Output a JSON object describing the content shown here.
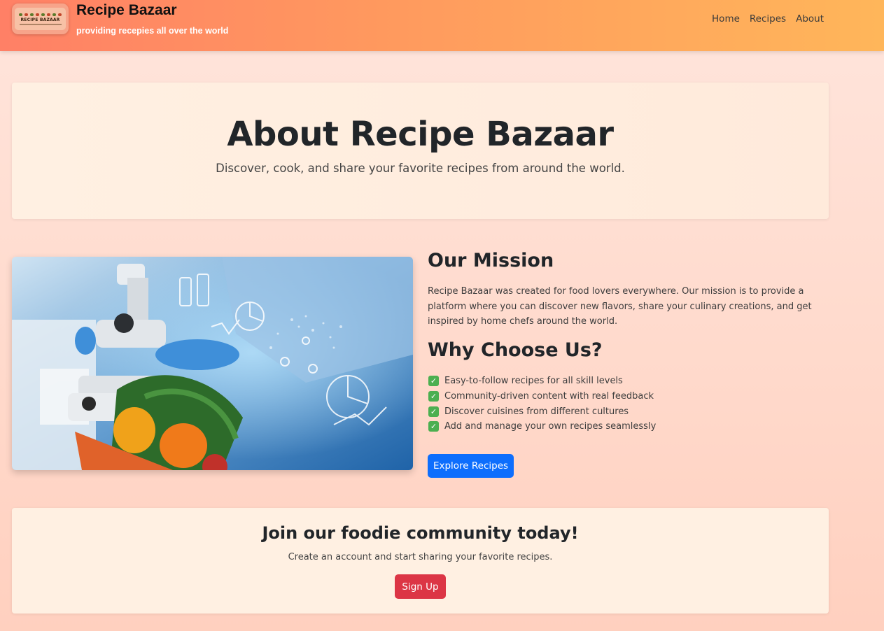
{
  "header": {
    "logo_text": "RECIPE BAZAAR",
    "brand_title": "Recipe Bazaar",
    "tagline": "providing recepies all over the world",
    "nav": [
      {
        "label": "Home"
      },
      {
        "label": "Recipes"
      },
      {
        "label": "About"
      }
    ]
  },
  "hero": {
    "title": "About Recipe Bazaar",
    "subtitle": "Discover, cook, and share your favorite recipes from around the world."
  },
  "mission": {
    "image_icon": "lab-vegetables-photo",
    "heading": "Our Mission",
    "body": "Recipe Bazaar was created for food lovers everywhere. Our mission is to provide a platform where you can discover new flavors, share your culinary creations, and get inspired by home chefs around the world.",
    "why_heading": "Why Choose Us?",
    "features": [
      {
        "icon": "check-icon",
        "text": "Easy-to-follow recipes for all skill levels"
      },
      {
        "icon": "check-icon",
        "text": "Community-driven content with real feedback"
      },
      {
        "icon": "check-icon",
        "text": "Discover cuisines from different cultures"
      },
      {
        "icon": "check-icon",
        "text": "Add and manage your own recipes seamlessly"
      }
    ],
    "explore_label": "Explore Recipes"
  },
  "join": {
    "heading": "Join our foodie community today!",
    "text": "Create an account and start sharing your favorite recipes.",
    "signup_label": "Sign Up"
  },
  "colors": {
    "primary_button": "#0d6efd",
    "danger_button": "#dc3545",
    "check_green": "#4caf50",
    "header_gradient_start": "#ff8066",
    "header_gradient_end": "#ffb65a"
  }
}
